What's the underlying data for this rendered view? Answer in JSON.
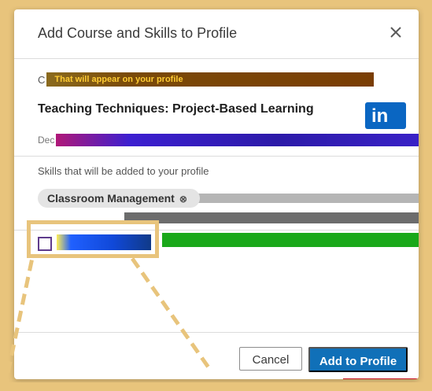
{
  "dialog": {
    "title": "Add Course and Skills to Profile",
    "close_icon": "close-icon"
  },
  "course": {
    "label_prefix": "C",
    "appear_banner": "That will appear on your profile",
    "title": "Teaching Techniques: Project-Based Learning",
    "date_prefix": "Dec",
    "logo": "linkedin-logo-icon",
    "logo_text": "in"
  },
  "skills": {
    "label": "Skills that will be added to your profile",
    "chips": [
      {
        "label": "Classroom Management",
        "remove_glyph": "⊗"
      }
    ]
  },
  "share": {
    "checkbox_checked": false
  },
  "footer": {
    "cancel_label": "Cancel",
    "submit_label": "Add to Profile"
  },
  "colors": {
    "frame": "#e8c47c",
    "primary": "#1070b8",
    "linkedin": "#0a66c2"
  }
}
